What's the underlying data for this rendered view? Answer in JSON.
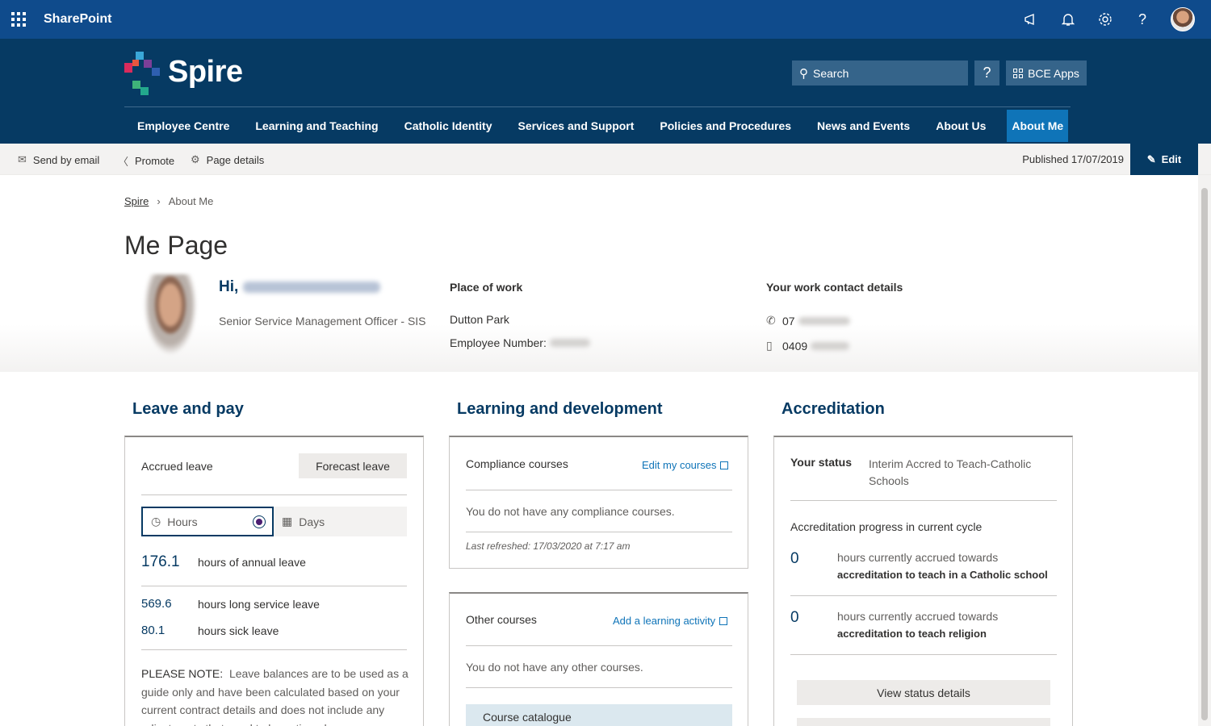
{
  "suitebar": {
    "brand": "SharePoint",
    "icons": [
      "megaphone-icon",
      "bell-icon",
      "gear-icon",
      "help-icon",
      "avatar"
    ]
  },
  "header": {
    "logo_text": "Spire",
    "search_placeholder": "Search",
    "help_label": "?",
    "apps_label": "BCE Apps",
    "nav": [
      {
        "label": "Employee Centre"
      },
      {
        "label": "Learning and Teaching"
      },
      {
        "label": "Catholic Identity"
      },
      {
        "label": "Services and Support"
      },
      {
        "label": "Policies and Procedures"
      },
      {
        "label": "News and Events"
      },
      {
        "label": "About Us"
      },
      {
        "label": "About Me",
        "active": true
      }
    ]
  },
  "commandbar": {
    "send_email": "Send by email",
    "promote": "Promote",
    "page_details": "Page details",
    "published": "Published 17/07/2019",
    "edit": "Edit"
  },
  "breadcrumb": [
    "Spire",
    "About Me"
  ],
  "page_title": "Me Page",
  "profile": {
    "greeting": "Hi,",
    "role": "Senior Service Management Officer - SIS",
    "place_heading": "Place of work",
    "place": "Dutton Park",
    "employee_number_label": "Employee Number:",
    "contact_heading": "Your work contact details",
    "phone_prefix": "07",
    "mobile_prefix": "0409"
  },
  "leave": {
    "title": "Leave and pay",
    "accrued_label": "Accrued leave",
    "forecast_label": "Forecast leave",
    "hours_label": "Hours",
    "days_label": "Days",
    "annual_value": "176.1",
    "annual_label": "hours of annual leave",
    "long_service_value": "569.6",
    "long_service_label": "hours long service leave",
    "sick_value": "80.1",
    "sick_label": "hours sick leave",
    "note_label": "PLEASE NOTE:",
    "note_text": "Leave balances are to be used as a guide only and have been calculated based on your current contract details and does not include any adjustments that need to be actioned."
  },
  "learning": {
    "title": "Learning and development",
    "compliance_heading": "Compliance courses",
    "edit_link": "Edit my courses",
    "compliance_empty": "You do not have any compliance courses.",
    "refreshed": "Last refreshed: 17/03/2020 at 7:17 am",
    "other_heading": "Other courses",
    "add_link": "Add a learning activity",
    "other_empty": "You do not have any other courses.",
    "catalogue": "Course catalogue"
  },
  "accreditation": {
    "title": "Accreditation",
    "status_label": "Your status",
    "status_value": "Interim Accred to Teach-Catholic Schools",
    "progress_heading": "Accreditation progress in current cycle",
    "item1_value": "0",
    "item1_line1": "hours currently accrued towards",
    "item1_line2": "accreditation to teach in a Catholic school",
    "item2_value": "0",
    "item2_line1": "hours currently accrued towards",
    "item2_line2": "accreditation to teach religion",
    "view_button": "View status details"
  }
}
